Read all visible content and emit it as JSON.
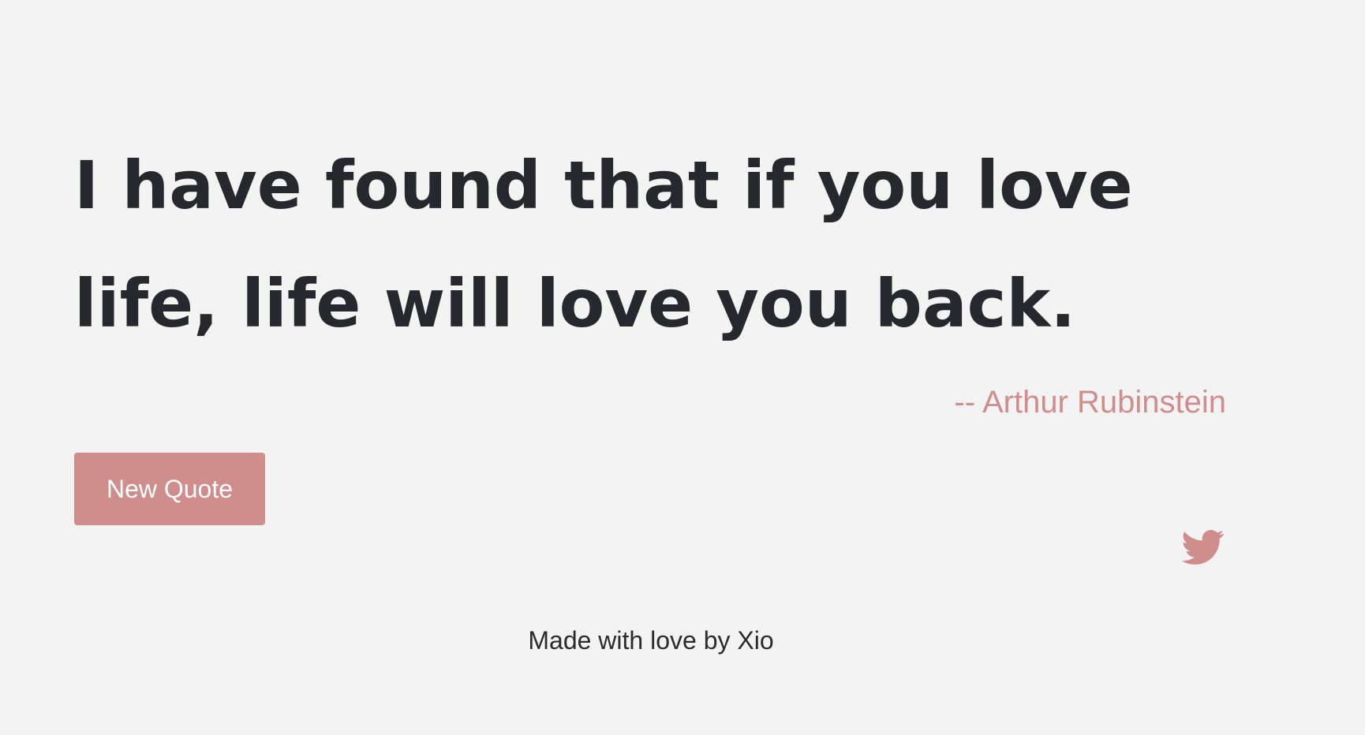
{
  "quote": {
    "text": "I have found that if you love life, life will love you back.",
    "author": "-- Arthur Rubinstein"
  },
  "actions": {
    "new_quote_label": "New Quote",
    "tweet_icon": "twitter-icon"
  },
  "footer": {
    "text": "Made with love by Xio"
  },
  "colors": {
    "background": "#f3f3f3",
    "quote_text": "#25282d",
    "accent": "#cf8e8c",
    "button_text": "#ffffff",
    "footer_text": "#2b2b2b"
  }
}
